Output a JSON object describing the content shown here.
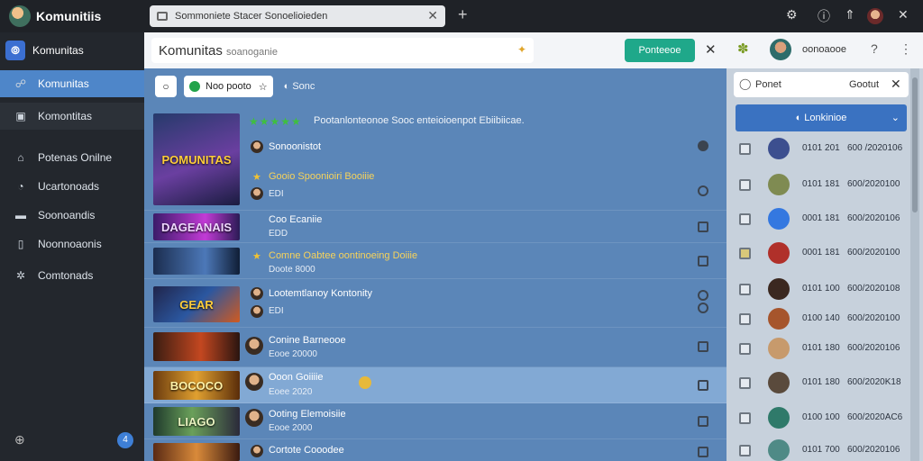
{
  "titlebar": {
    "app_title": "Komunitiis",
    "tab_title": "Sommoniete Stacer Sonoelioieden",
    "close": "✕",
    "new_tab": "+",
    "icons": [
      "puzzle-icon",
      "help-icon",
      "upload-icon",
      "avatar",
      "close-icon"
    ]
  },
  "sidebar": {
    "brand": "Komunitas",
    "items": [
      {
        "label": "Komunitas",
        "icon": "people-icon",
        "active": true
      },
      {
        "label": "Komontitas",
        "icon": "briefcase-icon"
      },
      {
        "label": "Potenas Onilne",
        "icon": "home-icon"
      },
      {
        "label": "Ucartonoads",
        "icon": "chat-icon"
      },
      {
        "label": "Soonoandis",
        "icon": "folder-icon"
      },
      {
        "label": "Noonnoaonis",
        "icon": "book-icon"
      },
      {
        "label": "Comtonads",
        "icon": "gear-icon"
      }
    ],
    "badge": "4"
  },
  "topbar": {
    "search_value": "Komunitas",
    "search_hint": "soanoganie",
    "primary_button": "Ponteeoe",
    "user_label": "oonoaooe"
  },
  "filters": {
    "chip_label": "Noo pooto",
    "filter_text": "Sonc"
  },
  "featured": {
    "thumb_text": "POMUNITAS",
    "rating": "★★★★★",
    "rating_text": "Pootanlonteonoe Sooc enteioioenpot Ebiibiicae.",
    "title": "Sonoonistot",
    "star_title": "Gooio Spoonioiri Booiiie",
    "meta": "EDI"
  },
  "rows": [
    {
      "thumb_text": "DAGEANAIS",
      "title": "Coo Ecaniie",
      "sub": "EDD",
      "star": false
    },
    {
      "thumb_text": "",
      "title": "Comne Oabtee oontinoeing Doiiie",
      "sub": "Doote 8000",
      "star": true
    },
    {
      "thumb_text": "GEAR",
      "title": "Lootemtlanoy Kontonity",
      "sub": "EDI",
      "star": false
    },
    {
      "thumb_text": "",
      "title": "Conine Barneooe",
      "sub": "Eooe 20000",
      "star": false
    },
    {
      "thumb_text": "BOCOCO",
      "title": "Ooon Goiiiie",
      "sub": "Eoee 2020",
      "star": false
    },
    {
      "thumb_text": "LIAGO",
      "title": "Ooting Elemoisiie",
      "sub": "Eooe 2000",
      "star": false
    },
    {
      "thumb_text": "",
      "title": "Cortote Cooodee",
      "sub": "",
      "star": false
    }
  ],
  "right_panel": {
    "search_left": "Ponet",
    "search_right": "Gootut",
    "select_label": "Lonkinioe",
    "rows": [
      {
        "num": "0101 201",
        "val": "600 /2020106",
        "color": "#3c4f8f"
      },
      {
        "num": "0101 181",
        "val": "600/2020100",
        "color": "#7f8b52"
      },
      {
        "num": "0001 181",
        "val": "600/2020106",
        "color": "#3478e0"
      },
      {
        "num": "0001 181",
        "val": "600/2020100",
        "color": "#b0302a"
      },
      {
        "num": "0101 100",
        "val": "600/2020108",
        "color": "#3b2820"
      },
      {
        "num": "0100 140",
        "val": "600/2020100",
        "color": "#a6552c"
      },
      {
        "num": "0101 180",
        "val": "600/2020106",
        "color": "#c79a6c"
      },
      {
        "num": "0101 180",
        "val": "600/2020K18",
        "color": "#5a4a3c"
      },
      {
        "num": "0100 100",
        "val": "600/2020AC6",
        "color": "#2f7a6a"
      },
      {
        "num": "0101 700",
        "val": "600/2020106",
        "color": "#4f8a86"
      }
    ]
  },
  "colors": {
    "accent": "#4e86c9",
    "primary_button": "#1fa88a",
    "main_bg": "#5b86b8"
  }
}
